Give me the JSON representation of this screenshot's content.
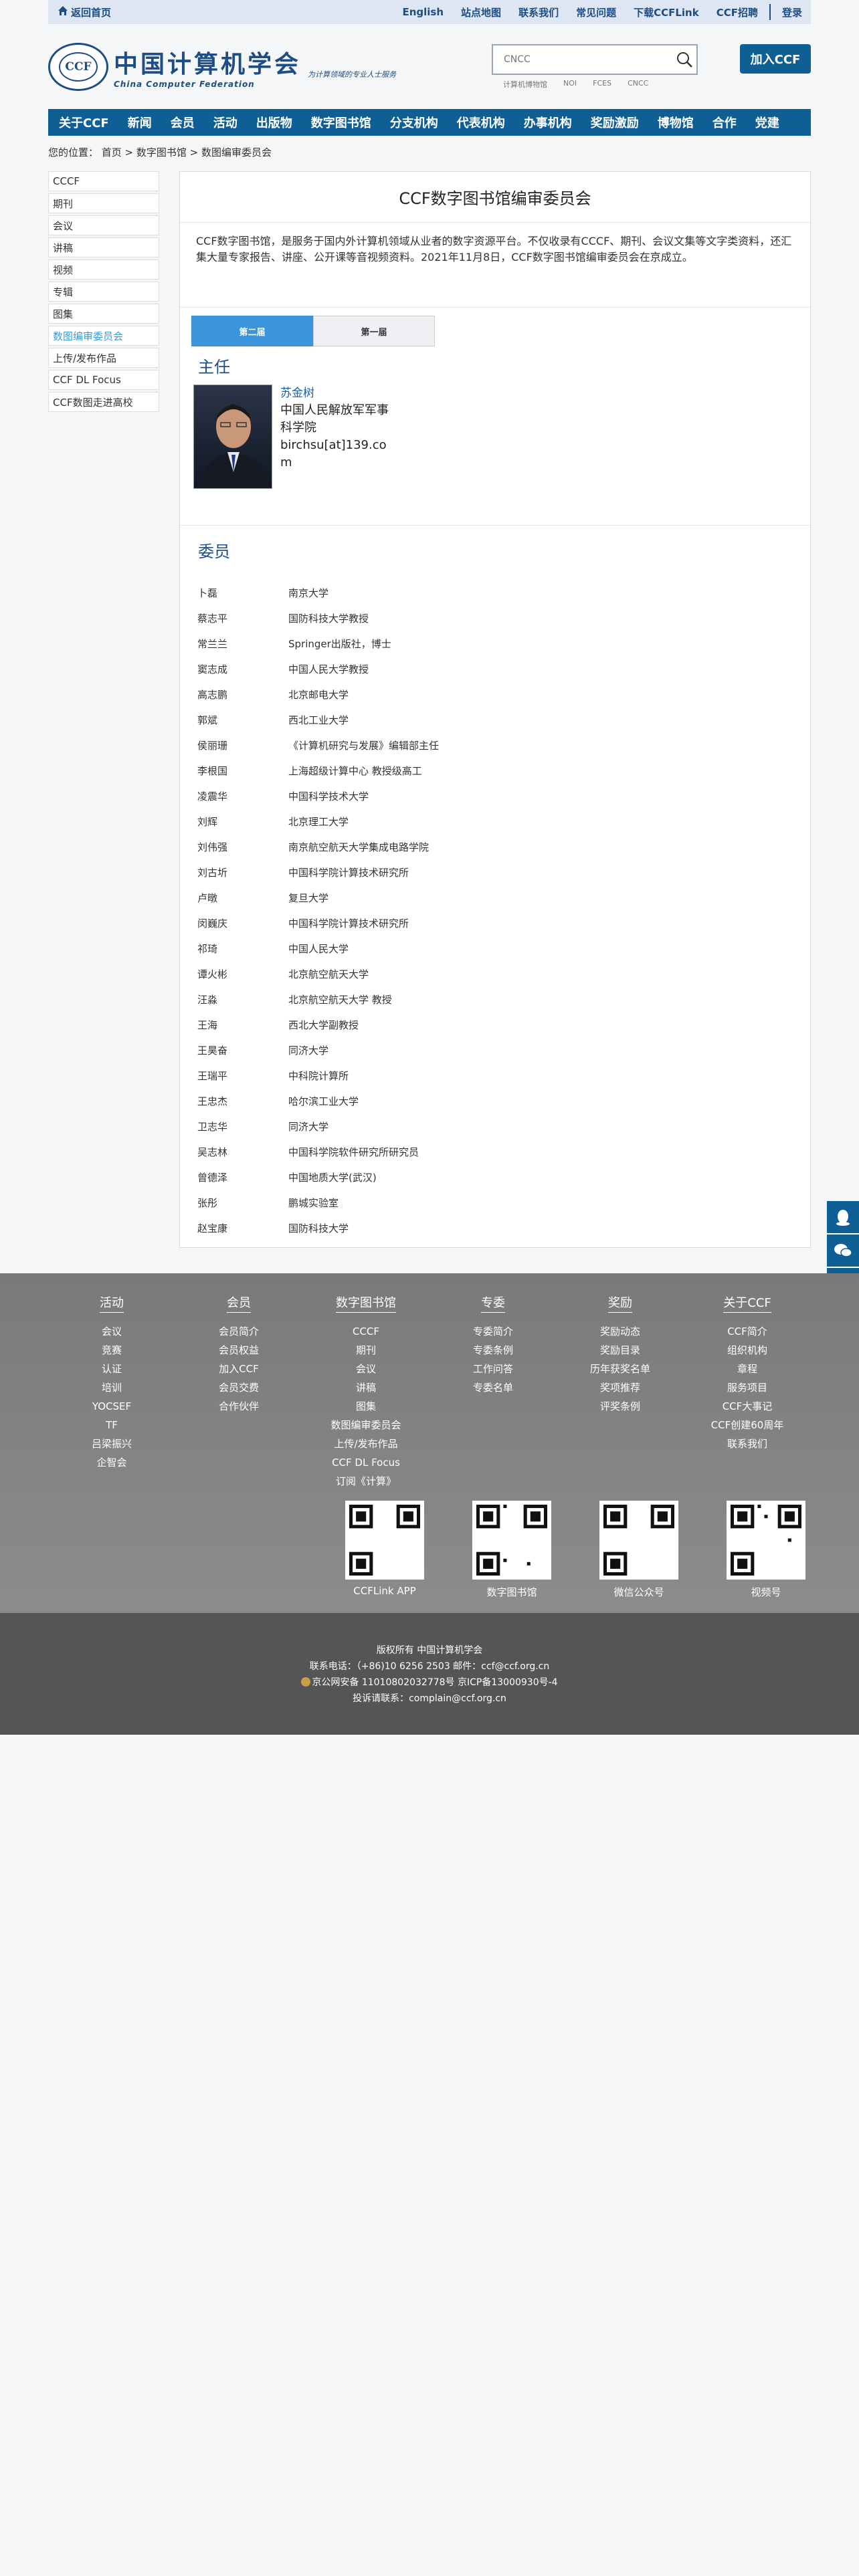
{
  "topbar": {
    "home": "返回首页",
    "links": [
      "English",
      "站点地图",
      "联系我们",
      "常见问题",
      "下载CCFLink",
      "CCF招聘",
      "登录"
    ]
  },
  "header": {
    "logo_cn": "中国计算机学会",
    "logo_en": "China Computer Federation",
    "slogan": "为计算领域的专业人士服务",
    "seal": "CCF",
    "search_placeholder": "CNCC",
    "hot_links": [
      "计算机博物馆",
      "NOI",
      "FCES",
      "CNCC"
    ],
    "join": "加入CCF"
  },
  "nav": [
    "关于CCF",
    "新闻",
    "会员",
    "活动",
    "出版物",
    "数字图书馆",
    "分支机构",
    "代表机构",
    "办事机构",
    "奖励激励",
    "博物馆",
    "合作",
    "党建"
  ],
  "breadcrumb": "您的位置： 首页 > 数字图书馆 > 数图编审委员会",
  "sidebar": [
    "CCCF",
    "期刊",
    "会议",
    "讲稿",
    "视频",
    "专辑",
    "图集",
    "数图编审委员会",
    "上传/发布作品",
    "CCF DL Focus",
    "CCF数图走进高校"
  ],
  "main": {
    "title": "CCF数字图书馆编审委员会",
    "intro": "CCF数字图书馆，是服务于国内外计算机领域从业者的数字资源平台。不仅收录有CCCF、期刊、会议文集等文字类资料，还汇集大量专家报告、讲座、公开课等音视频资料。2021年11月8日，CCF数字图书馆编审委员会在京成立。",
    "tabs": [
      "第二届",
      "第一届"
    ],
    "director_heading": "主任",
    "director": {
      "name": "苏金树",
      "org": "中国人民解放军军事科学院",
      "email": "birchsu[at]139.com"
    },
    "members_heading": "委员",
    "members": [
      [
        "卜磊",
        "南京大学"
      ],
      [
        "蔡志平",
        "国防科技大学教授"
      ],
      [
        "常兰兰",
        "Springer出版社，博士"
      ],
      [
        "窦志成",
        "中国人民大学教授"
      ],
      [
        "高志鹏",
        "北京邮电大学"
      ],
      [
        "郭斌",
        "西北工业大学"
      ],
      [
        "侯丽珊",
        "《计算机研究与发展》编辑部主任"
      ],
      [
        "李根国",
        "上海超级计算中心 教授级高工"
      ],
      [
        "凌震华",
        "中国科学技术大学"
      ],
      [
        "刘辉",
        "北京理工大学"
      ],
      [
        "刘伟强",
        "南京航空航天大学集成电路学院"
      ],
      [
        "刘古圻",
        "中国科学院计算技术研究所"
      ],
      [
        "卢暾",
        "复旦大学"
      ],
      [
        "闵巍庆",
        "中国科学院计算技术研究所"
      ],
      [
        "祁琦",
        "中国人民大学"
      ],
      [
        "谭火彬",
        "北京航空航天大学"
      ],
      [
        "汪淼",
        "北京航空航天大学 教授"
      ],
      [
        "王海",
        "西北大学副教授"
      ],
      [
        "王昊奋",
        "同济大学"
      ],
      [
        "王瑞平",
        "中科院计算所"
      ],
      [
        "王忠杰",
        "哈尔滨工业大学"
      ],
      [
        "卫志华",
        "同济大学"
      ],
      [
        "吴志林",
        "中国科学院软件研究所研究员"
      ],
      [
        "曾德泽",
        "中国地质大学(武汉)"
      ],
      [
        "张彤",
        "鹏城实验室"
      ],
      [
        "赵宝康",
        "国防科技大学"
      ]
    ]
  },
  "footer": {
    "columns": [
      {
        "h": "活动",
        "items": [
          "会议",
          "竞赛",
          "认证",
          "培训",
          "YOCSEF",
          "TF",
          "吕梁振兴",
          "企智会"
        ]
      },
      {
        "h": "会员",
        "items": [
          "会员简介",
          "会员权益",
          "加入CCF",
          "会员交费",
          "合作伙伴"
        ]
      },
      {
        "h": "数字图书馆",
        "items": [
          "CCCF",
          "期刊",
          "会议",
          "讲稿",
          "图集",
          "数图编审委员会",
          "上传/发布作品",
          "CCF DL Focus",
          "订阅《计算》"
        ]
      },
      {
        "h": "专委",
        "items": [
          "专委简介",
          "专委条例",
          "工作问答",
          "专委名单"
        ]
      },
      {
        "h": "奖励",
        "items": [
          "奖励动态",
          "奖励目录",
          "历年获奖名单",
          "奖项推荐",
          "评奖条例"
        ]
      },
      {
        "h": "关于CCF",
        "items": [
          "CCF简介",
          "组织机构",
          "章程",
          "服务项目",
          "CCF大事记",
          "CCF创建60周年",
          "联系我们"
        ]
      }
    ],
    "qrs": [
      "CCFLink APP",
      "数字图书馆",
      "微信公众号",
      "视频号"
    ]
  },
  "bottom": {
    "l1": "版权所有 中国计算机学会",
    "l2": "联系电话：（+86)10 6256 2503 邮件：ccf@ccf.org.cn",
    "l3": "京公网安备 11010802032778号   京ICP备13000930号-4",
    "l4": "投诉请联系：complain@ccf.org.cn"
  },
  "colors": {
    "brand": "#0f5f94",
    "tab_active": "#3b95dd",
    "footer": "#808080"
  }
}
